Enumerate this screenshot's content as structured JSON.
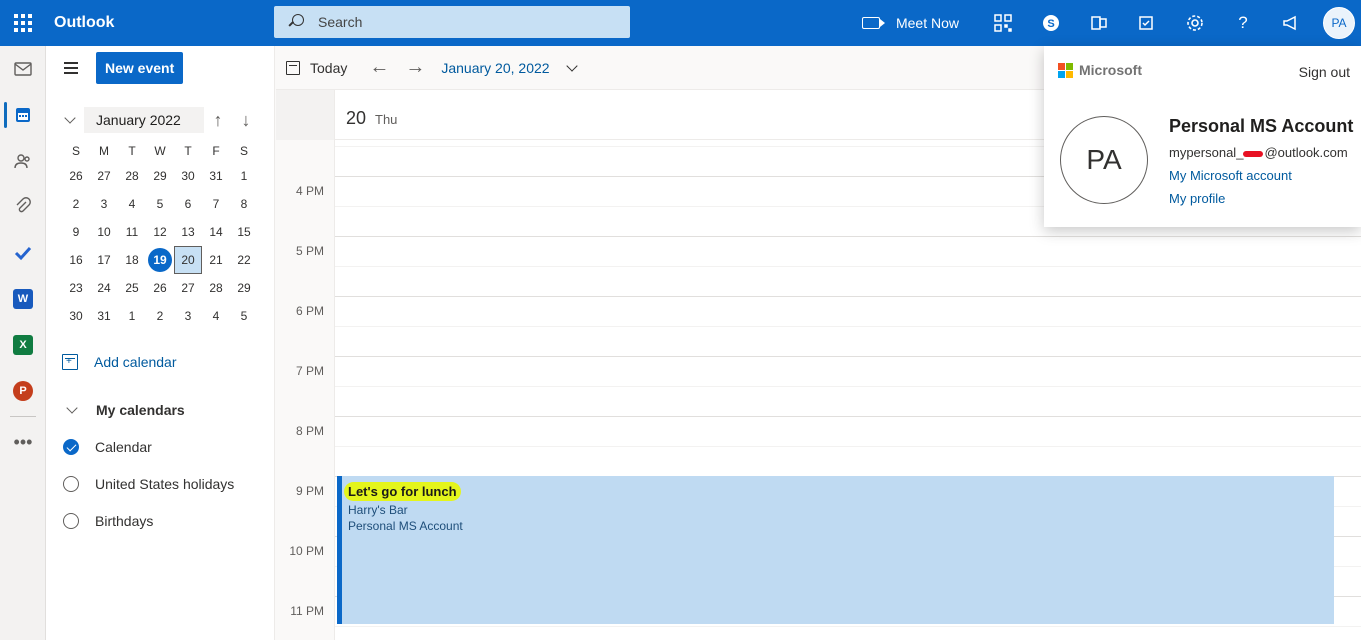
{
  "app": {
    "title": "Outlook"
  },
  "search": {
    "placeholder": "Search"
  },
  "topbar": {
    "meet_now": "Meet Now",
    "help": "?",
    "avatar_initials": "PA"
  },
  "sidebar": {
    "new_event": "New event",
    "mini_calendar": {
      "month_label": "January 2022",
      "weekdays": [
        "S",
        "M",
        "T",
        "W",
        "T",
        "F",
        "S"
      ],
      "weeks": [
        [
          "26",
          "27",
          "28",
          "29",
          "30",
          "31",
          "1"
        ],
        [
          "2",
          "3",
          "4",
          "5",
          "6",
          "7",
          "8"
        ],
        [
          "9",
          "10",
          "11",
          "12",
          "13",
          "14",
          "15"
        ],
        [
          "16",
          "17",
          "18",
          "19",
          "20",
          "21",
          "22"
        ],
        [
          "23",
          "24",
          "25",
          "26",
          "27",
          "28",
          "29"
        ],
        [
          "30",
          "31",
          "1",
          "2",
          "3",
          "4",
          "5"
        ]
      ],
      "today": "19",
      "selected": "20"
    },
    "add_calendar": "Add calendar",
    "my_calendars_label": "My calendars",
    "calendars": [
      {
        "name": "Calendar",
        "checked": true
      },
      {
        "name": "United States holidays",
        "checked": false
      },
      {
        "name": "Birthdays",
        "checked": false
      }
    ]
  },
  "toolbar": {
    "today": "Today",
    "date_label": "January 20, 2022"
  },
  "day_header": {
    "day_number": "20",
    "day_of_week": "Thu"
  },
  "hours": [
    "4 PM",
    "5 PM",
    "6 PM",
    "7 PM",
    "8 PM",
    "9 PM",
    "10 PM",
    "11 PM"
  ],
  "event": {
    "title": "Let's go for lunch",
    "location": "Harry's Bar",
    "calendar": "Personal MS Account"
  },
  "account_popup": {
    "brand": "Microsoft",
    "sign_out": "Sign out",
    "initials": "PA",
    "name": "Personal MS Account",
    "email_prefix": "mypersonal_",
    "email_suffix": "@outlook.com",
    "my_account": "My Microsoft account",
    "my_profile": "My profile"
  },
  "colors": {
    "accent": "#0a68c8",
    "event_bg": "#bfdaf2",
    "highlight": "#e4f51b"
  }
}
